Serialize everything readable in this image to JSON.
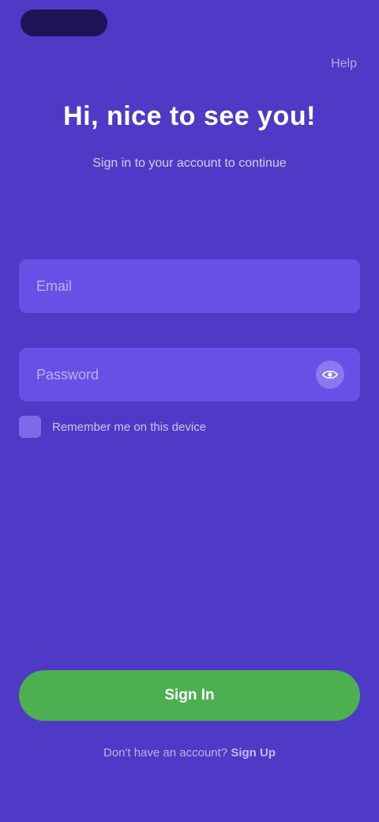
{
  "header": {
    "top_link": "Help",
    "title": "Hi, nice to see you!",
    "subtitle": "Sign in to your account to continue"
  },
  "form": {
    "email_placeholder": "Email",
    "password_placeholder": "Password",
    "remember_label": "Remember me on this device",
    "submit_label": "Sign In"
  },
  "footer": {
    "prompt": "Don't have an account?",
    "link": "Sign Up"
  },
  "colors": {
    "background": "#4f3ac7",
    "field": "#6650e6",
    "primary_button": "#4caf50"
  }
}
